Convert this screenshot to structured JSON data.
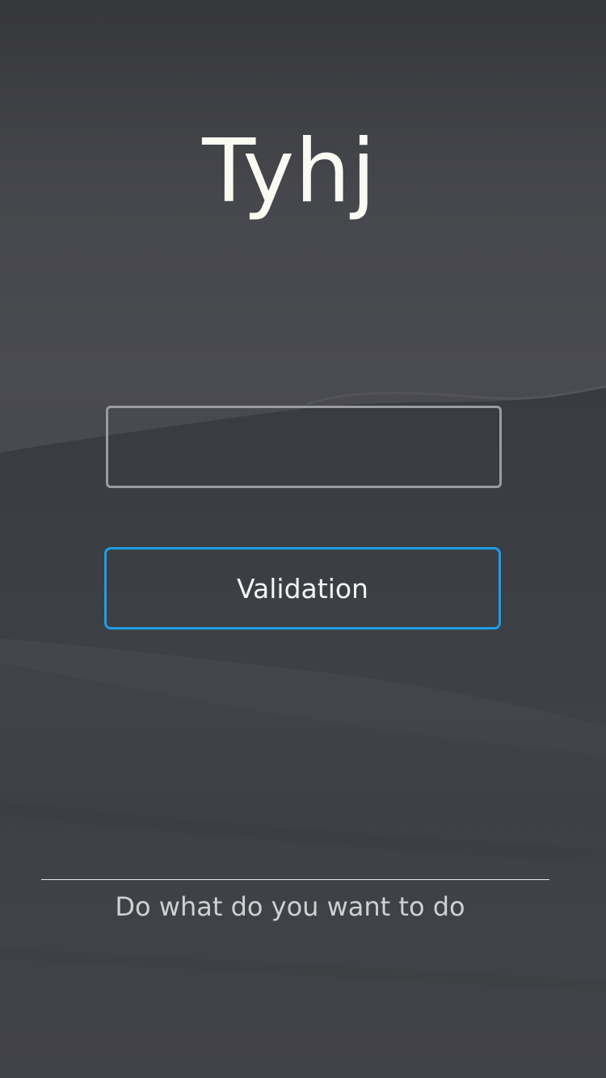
{
  "app": {
    "title": "Tyhj"
  },
  "form": {
    "code_input": {
      "value": "",
      "placeholder": ""
    },
    "validate_label": "Validation"
  },
  "footer": {
    "tagline": "Do what do you want to do"
  },
  "colors": {
    "accent": "#1c9de4",
    "background": "#45474c",
    "title_text": "#fbfaf2",
    "input_border": "#9b9c9f",
    "tagline_text": "#cfd0d2"
  }
}
